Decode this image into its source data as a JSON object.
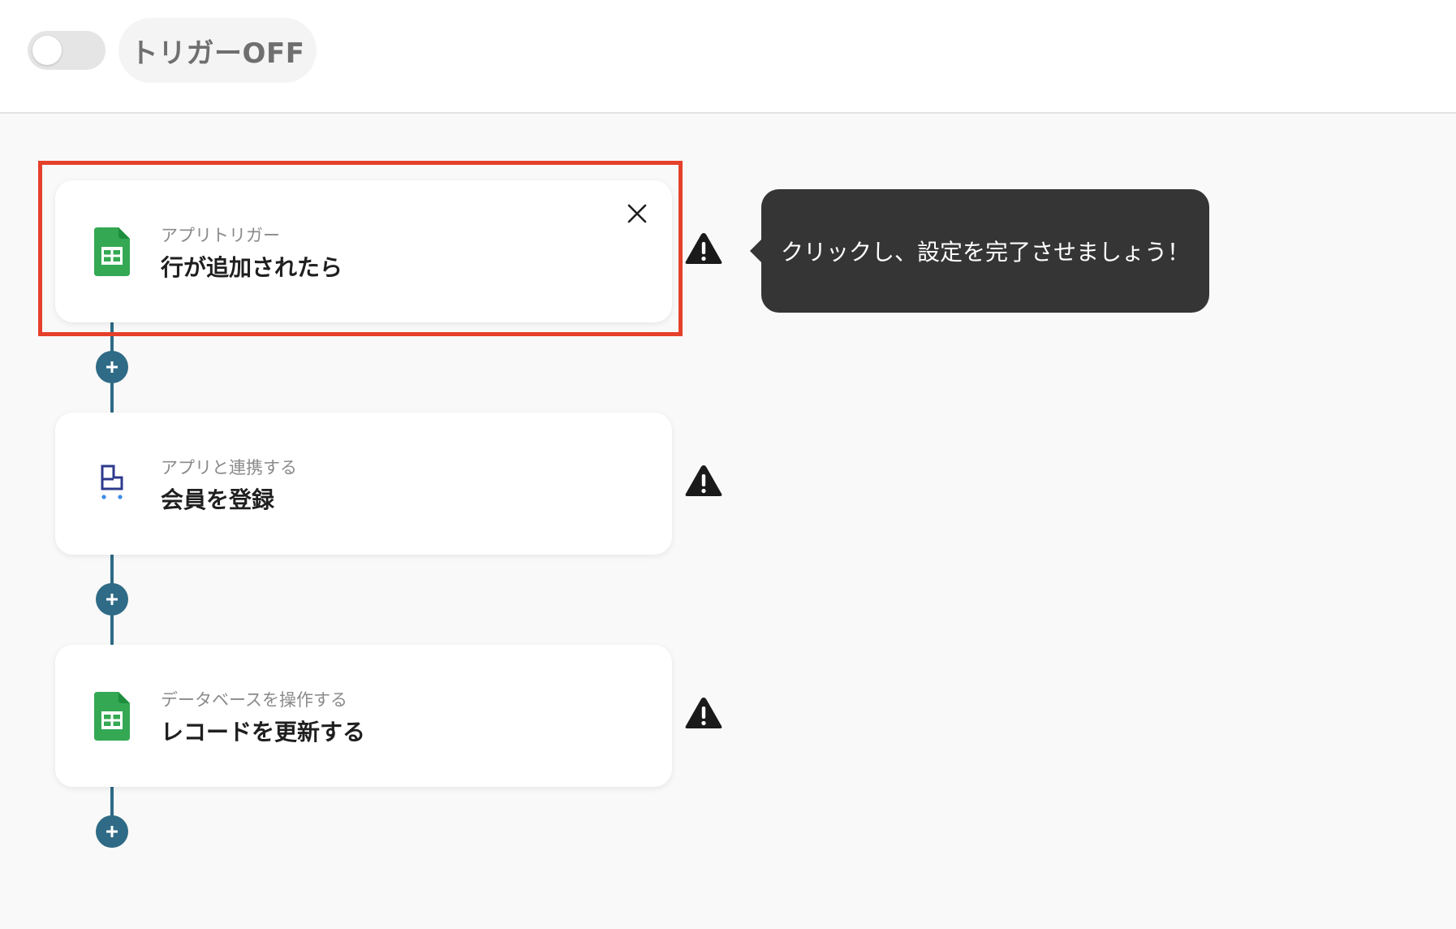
{
  "header": {
    "trigger_toggle_state": "off",
    "trigger_label": "トリガーOFF"
  },
  "steps": [
    {
      "icon": "google-sheets-icon",
      "subtitle": "アプリトリガー",
      "title": "行が追加されたら",
      "status": "warning",
      "highlighted": true
    },
    {
      "icon": "member-app-icon",
      "subtitle": "アプリと連携する",
      "title": "会員を登録",
      "status": "warning",
      "highlighted": false
    },
    {
      "icon": "google-sheets-icon",
      "subtitle": "データベースを操作する",
      "title": "レコードを更新する",
      "status": "warning",
      "highlighted": false
    }
  ],
  "tooltip": {
    "text": "クリックし、設定を完了させましょう！"
  },
  "colors": {
    "flow_accent": "#2f6b86",
    "highlight": "#e5402a",
    "sheets_green": "#34a853",
    "tooltip_bg": "#353535"
  }
}
